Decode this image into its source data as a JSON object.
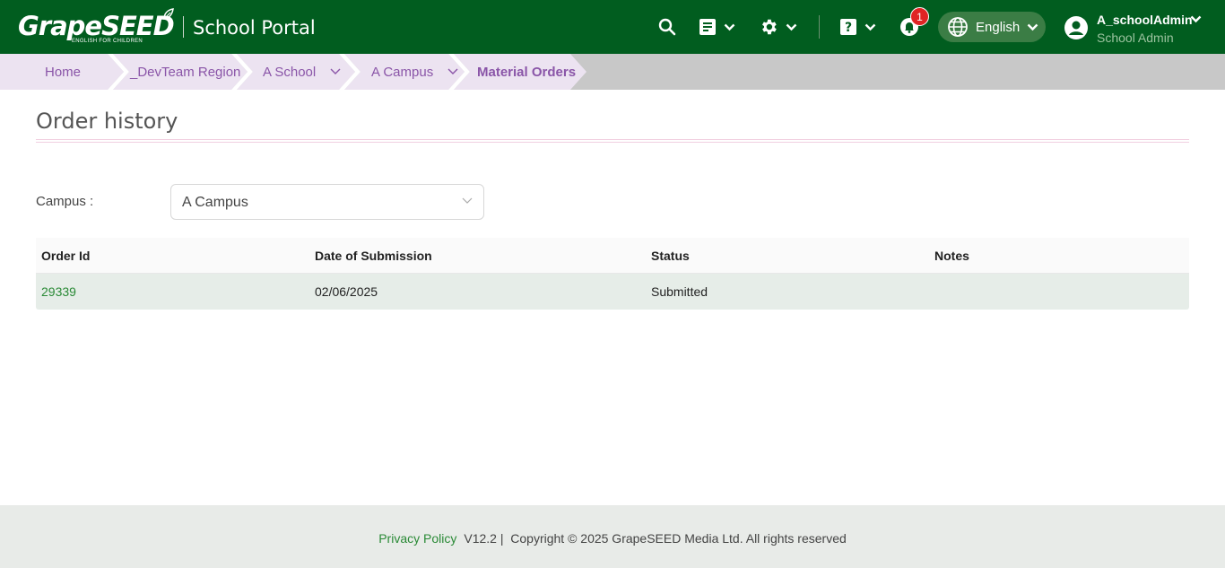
{
  "header": {
    "logo_text": "GrapeSEED",
    "logo_tagline": "ENGLISH FOR CHILDREN",
    "portal_title": "School Portal",
    "notification_count": "1",
    "language": "English",
    "user_name": "A_schoolAdmin",
    "user_role": "School Admin"
  },
  "breadcrumb": [
    {
      "label": "Home"
    },
    {
      "label": "_DevTeam Region"
    },
    {
      "label": "A School"
    },
    {
      "label": "A Campus"
    },
    {
      "label": "Material Orders"
    }
  ],
  "page": {
    "title": "Order history"
  },
  "filter": {
    "campus_label": "Campus :",
    "campus_value": "A Campus"
  },
  "table": {
    "columns": [
      "Order Id",
      "Date of Submission",
      "Status",
      "Notes"
    ],
    "rows": [
      {
        "order_id": "29339",
        "date": "02/06/2025",
        "status": "Submitted",
        "notes": ""
      }
    ]
  },
  "footer": {
    "privacy_label": "Privacy Policy",
    "version": "V12.2 |",
    "copyright": "Copyright © 2025 GrapeSEED Media Ltd. All rights reserved"
  },
  "colors": {
    "header_bg": "#015d1f",
    "accent_purple": "#8a55a8",
    "link_green": "#2a8a36",
    "badge_red": "#e02424"
  }
}
